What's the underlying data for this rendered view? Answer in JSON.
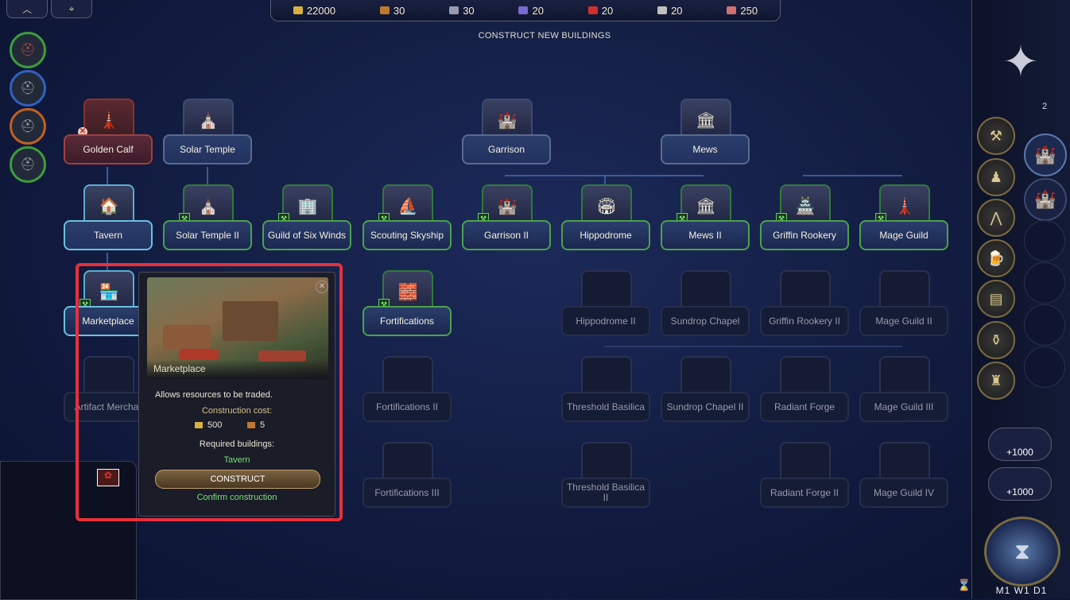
{
  "resources": [
    {
      "icon": "gold-icon",
      "value": "22000",
      "color": "#d8b040"
    },
    {
      "icon": "wood-icon",
      "value": "30",
      "color": "#c07830"
    },
    {
      "icon": "ore-icon",
      "value": "30",
      "color": "#9a9ab0"
    },
    {
      "icon": "crystal-icon",
      "value": "20",
      "color": "#7a6ad0"
    },
    {
      "icon": "dragon-blood-icon",
      "value": "20",
      "color": "#d03030"
    },
    {
      "icon": "mercury-icon",
      "value": "20",
      "color": "#c0c0c0"
    },
    {
      "icon": "gem-icon",
      "value": "250",
      "color": "#d07070"
    }
  ],
  "screen_title": "CONSTRUCT NEW BUILDINGS",
  "buildings": {
    "golden_calf": "Golden Calf",
    "solar_temple": "Solar Temple",
    "garrison": "Garrison",
    "mews": "Mews",
    "tavern": "Tavern",
    "solar_temple_2": "Solar Temple II",
    "guild_six_winds": "Guild of Six Winds",
    "scouting_skyship": "Scouting Skyship",
    "garrison_2": "Garrison II",
    "hippodrome": "Hippodrome",
    "mews_2": "Mews II",
    "griffin_rookery": "Griffin Rookery",
    "mage_guild": "Mage Guild",
    "marketplace": "Marketplace",
    "fortifications": "Fortifications",
    "hippodrome_2": "Hippodrome II",
    "sundrop_chapel": "Sundrop Chapel",
    "griffin_rookery_2": "Griffin Rookery II",
    "mage_guild_2": "Mage Guild II",
    "artifact_merchant": "Artifact Merchar",
    "fortifications_2": "Fortifications II",
    "threshold_basilica": "Threshold Basilica",
    "sundrop_chapel_2": "Sundrop Chapel II",
    "radiant_forge": "Radiant Forge",
    "mage_guild_3": "Mage Guild III",
    "fortifications_3": "Fortifications III",
    "threshold_basilica_2": "Threshold Basilica II",
    "radiant_forge_2": "Radiant Forge II",
    "mage_guild_4": "Mage Guild IV"
  },
  "tooltip": {
    "name": "Marketplace",
    "description": "Allows resources to be traded.",
    "cost_label": "Construction cost:",
    "cost_gold": "500",
    "cost_wood": "5",
    "required_label": "Required buildings:",
    "required": "Tavern",
    "construct_label": "CONSTRUCT",
    "confirm_label": "Confirm construction"
  },
  "right_panel": {
    "counter": "2",
    "bonus_1": "+1000",
    "bonus_2": "+1000",
    "date": "M1 W1 D1"
  }
}
